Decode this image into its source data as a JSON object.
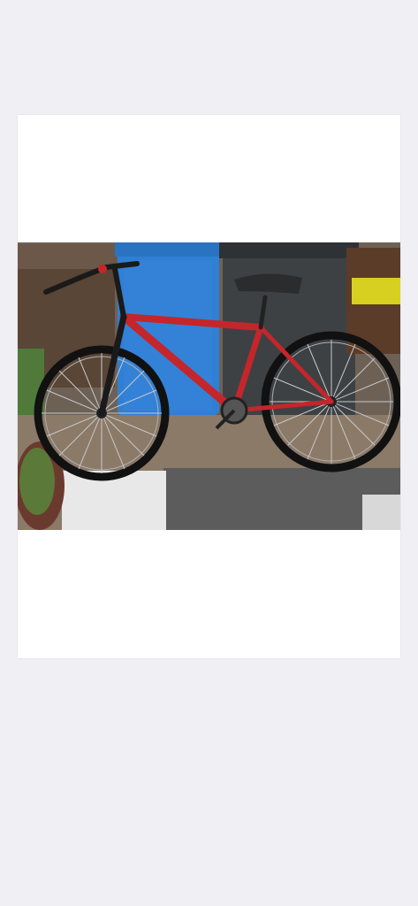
{
  "screen": {
    "background": "#efeff4",
    "card_background": "#ffffff"
  },
  "photo": {
    "subject": "bicycle",
    "frame_color": "#c4262b",
    "bin_blue": "#2f7fd4",
    "bin_grey": "#3d4144"
  }
}
